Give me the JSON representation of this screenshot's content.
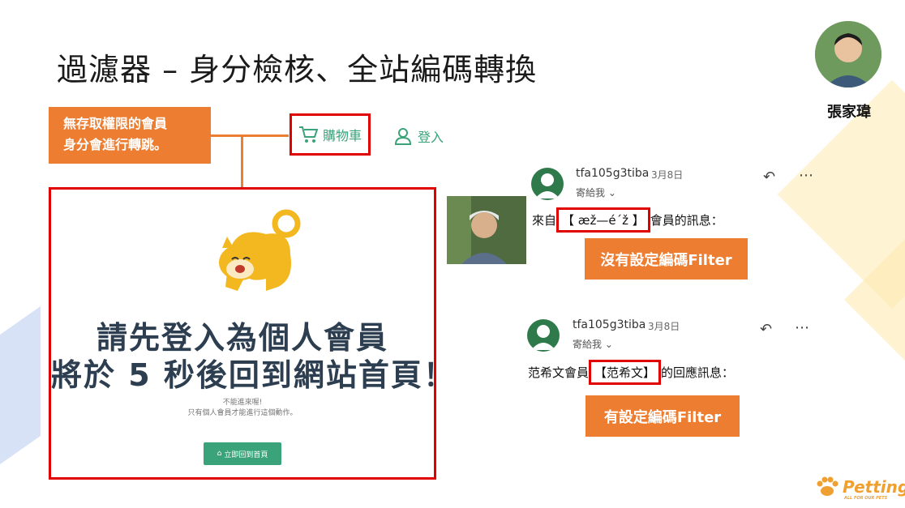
{
  "slide": {
    "title": "過濾器 – 身分檢核、全站編碼轉換",
    "presenter": "張家瑋",
    "callout": [
      "無存取權限的會員",
      "身分會進行轉跳。"
    ]
  },
  "site_nav": {
    "cart_label": "購物車",
    "login_label": "登入"
  },
  "login_required_page": {
    "headline_line1": "請先登入為個人會員",
    "headline_line2": "將於 5 秒後回到網站首頁！",
    "note_line1": "不能進來喔!",
    "note_line2": "只有個人會員才能進行這個動作。",
    "home_button": "立即回到首頁"
  },
  "emails": [
    {
      "sender": "tfa105g3tiba",
      "date": "3月8日",
      "to": "寄給我",
      "message_prefix": "來自",
      "highlighted": "【 æž—é´ž 】",
      "message_suffix": "會員的訊息：",
      "label": "沒有設定編碼Filter"
    },
    {
      "sender": "tfa105g3tiba",
      "date": "3月8日",
      "to": "寄給我",
      "message_prefix": "范希文會員",
      "highlighted": "【范希文】",
      "message_suffix": "的回應訊息：",
      "label": "有設定編碼Filter"
    }
  ],
  "brand": {
    "logo_text": "Petting",
    "tagline": "ALL FOR OUR PETS"
  },
  "colors": {
    "accent_orange": "#ed7d31",
    "highlight_red": "#e00000",
    "site_green": "#3aa37a"
  }
}
